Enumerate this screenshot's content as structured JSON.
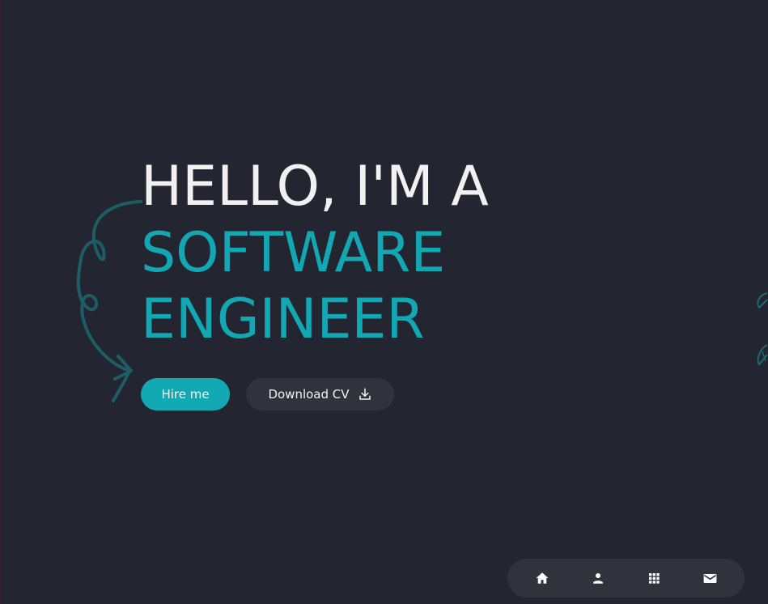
{
  "hero": {
    "line1": "HELLO, I'M A",
    "line2": "SOFTWARE",
    "line3": "ENGINEER"
  },
  "actions": {
    "hire_label": "Hire me",
    "download_label": "Download CV",
    "download_icon": "download-icon"
  },
  "nav": {
    "items": [
      {
        "name": "home",
        "icon": "home-icon"
      },
      {
        "name": "about",
        "icon": "person-icon"
      },
      {
        "name": "projects",
        "icon": "grid-icon"
      },
      {
        "name": "contact",
        "icon": "mail-icon"
      }
    ]
  },
  "colors": {
    "background": "#232630",
    "accent": "#13a7b3",
    "text": "#f1f1f1",
    "surface": "#30333c"
  }
}
